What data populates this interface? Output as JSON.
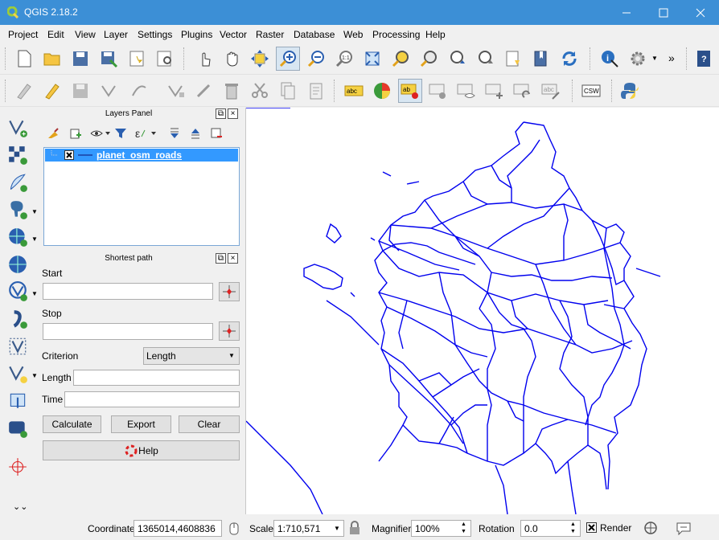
{
  "window": {
    "title": "QGIS 2.18.2"
  },
  "menu": [
    "Project",
    "Edit",
    "View",
    "Layer",
    "Settings",
    "Plugins",
    "Vector",
    "Raster",
    "Database",
    "Web",
    "Processing",
    "Help"
  ],
  "toolbar1": {
    "more": "»"
  },
  "toolbar2": {
    "abc1": "abc",
    "abc2": "ab",
    "abc3": "abc",
    "csw": "CSW"
  },
  "layers_panel": {
    "title": "Layers Panel",
    "layers": [
      {
        "name": "planet_osm_roads",
        "checked": true
      }
    ]
  },
  "shortest_path": {
    "title": "Shortest path",
    "start_label": "Start",
    "start_value": "",
    "stop_label": "Stop",
    "stop_value": "",
    "criterion_label": "Criterion",
    "criterion_value": "Length",
    "length_label": "Length",
    "length_value": "",
    "time_label": "Time",
    "time_value": "",
    "calculate": "Calculate",
    "export": "Export",
    "clear": "Clear",
    "help": "Help"
  },
  "status": {
    "coordinate_label": "Coordinate",
    "coordinate_value": "1365014,4608836",
    "scale_label": "Scale",
    "scale_value": "1:710,571",
    "magnifier_label": "Magnifier",
    "magnifier_value": "100%",
    "rotation_label": "Rotation",
    "rotation_value": "0.0",
    "render_label": "Render",
    "render_checked": true
  },
  "colors": {
    "titlebar": "#3c8fd6",
    "selection": "#3399ff",
    "roads": "#0000ee"
  }
}
